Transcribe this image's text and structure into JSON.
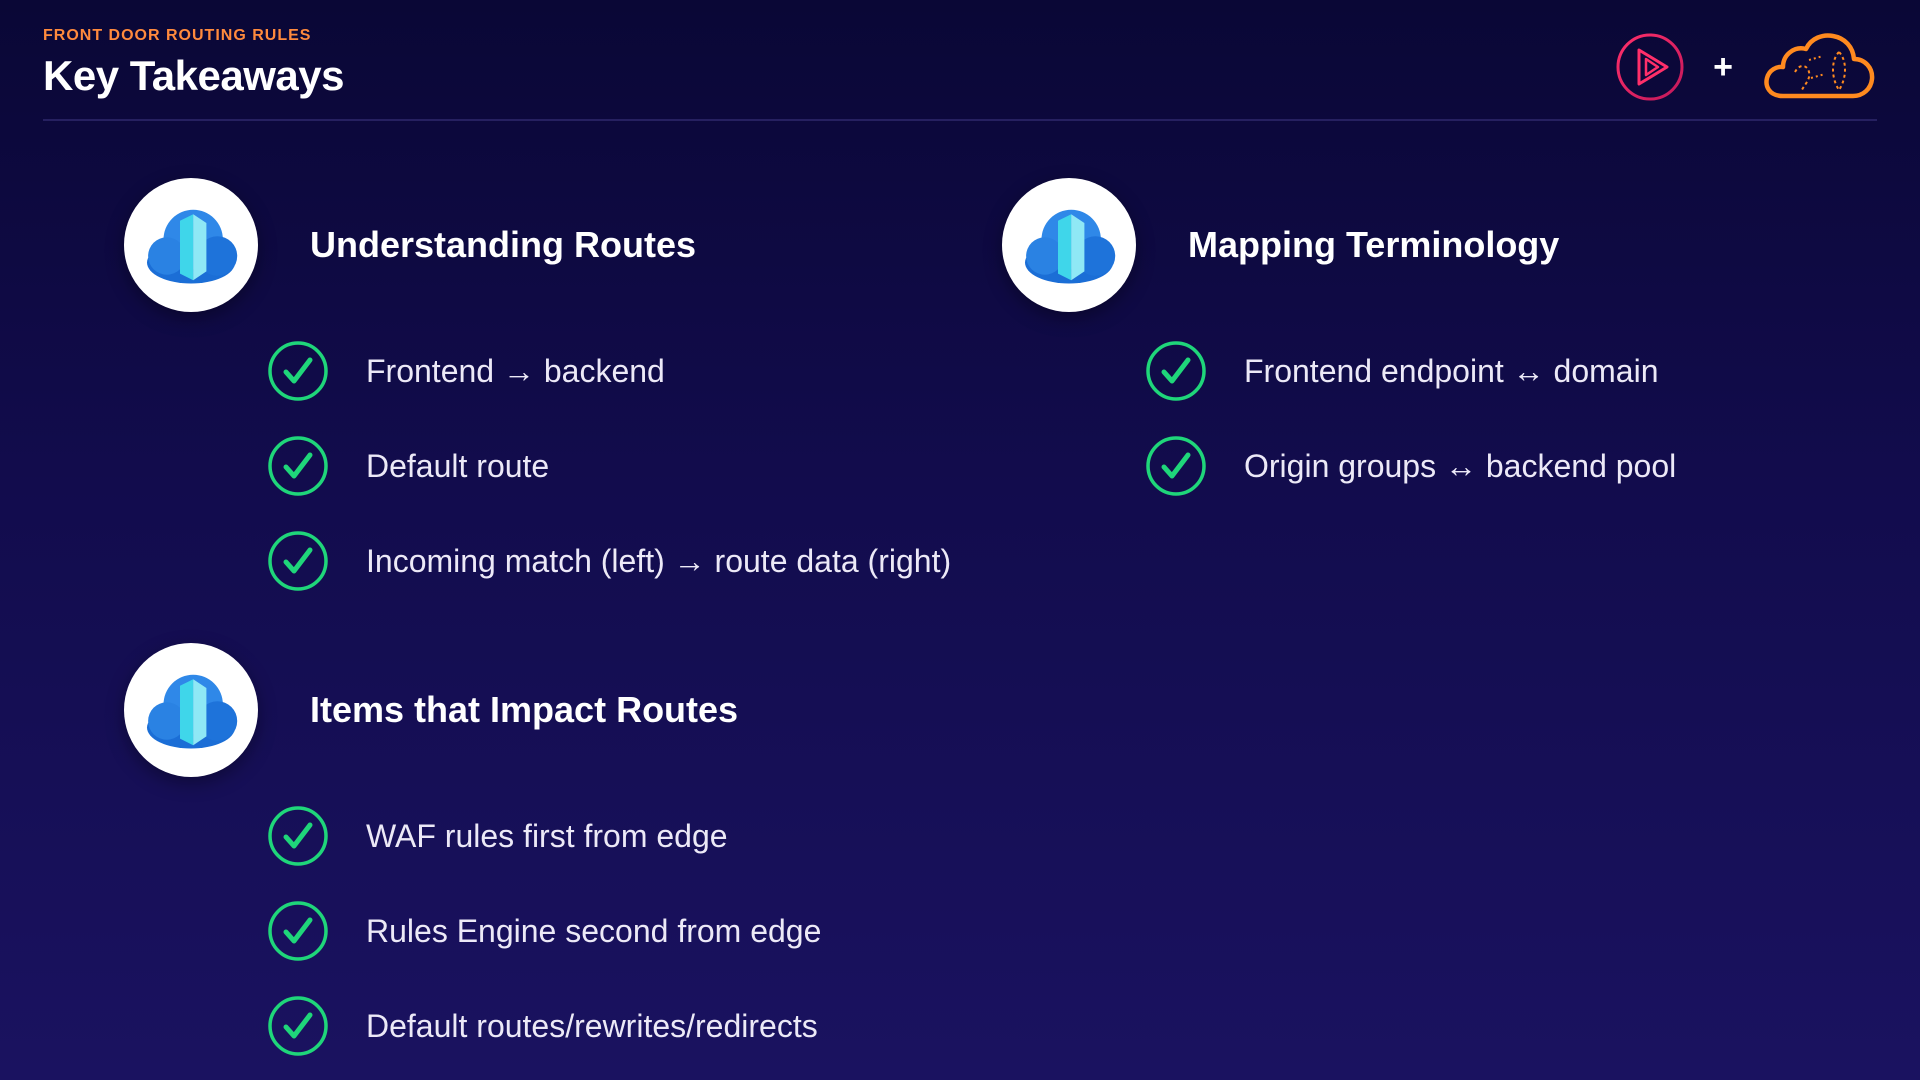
{
  "header": {
    "eyebrow": "FRONT DOOR ROUTING RULES",
    "title": "Key Takeaways"
  },
  "brand": {
    "play_logo_icon": "pluralsight-play-icon",
    "plus": "+",
    "cloud_logo_icon": "cloud-logo-icon"
  },
  "sections": [
    {
      "title": "Understanding Routes",
      "icon": "azure-front-door-icon",
      "items": [
        "Frontend → backend",
        "Default route",
        "Incoming match (left) → route data (right)"
      ]
    },
    {
      "title": "Mapping Terminology",
      "icon": "azure-front-door-icon",
      "items": [
        "Frontend endpoint ↔ domain",
        "Origin groups ↔ backend pool"
      ]
    },
    {
      "title": "Items that Impact Routes",
      "icon": "azure-front-door-icon",
      "items": [
        "WAF rules first from edge",
        "Rules Engine second from edge",
        "Default routes/rewrites/redirects"
      ]
    }
  ],
  "colors": {
    "accent": "#ff8a3d",
    "check": "#1fd67a",
    "background_top": "#0a0736",
    "background_bottom": "#1a1260"
  }
}
